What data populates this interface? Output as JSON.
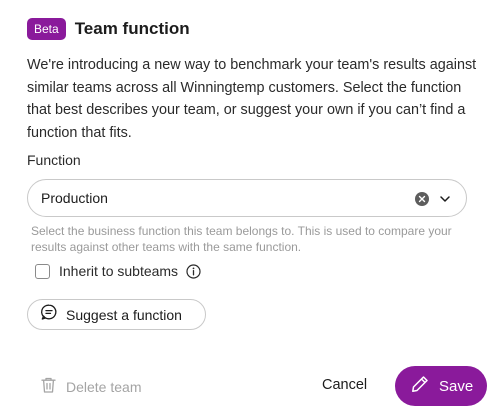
{
  "dialog": {
    "badge": "Beta",
    "title": "Team function",
    "description": "We're introducing a new way to benchmark your team's results against similar teams across all Winningtemp customers. Select the function that best describes your team, or suggest your own if you can’t find a function that fits."
  },
  "function_field": {
    "label": "Function",
    "value": "Production",
    "help_text": "Select the business function this team belongs to. This is used to compare your results against other teams with the same function."
  },
  "inherit": {
    "label": "Inherit to subteams",
    "checked": false
  },
  "actions": {
    "suggest_label": "Suggest a function",
    "delete_label": "Delete team",
    "cancel_label": "Cancel",
    "save_label": "Save"
  },
  "colors": {
    "accent": "#8a1a9b",
    "muted": "#a4a4a4",
    "border": "#c9c9c9"
  },
  "icons": {
    "clear": "clear-icon",
    "chevron": "chevron-down-icon",
    "info": "info-icon",
    "chat": "chat-bubble-icon",
    "trash": "trash-icon",
    "pencil": "pencil-icon"
  }
}
